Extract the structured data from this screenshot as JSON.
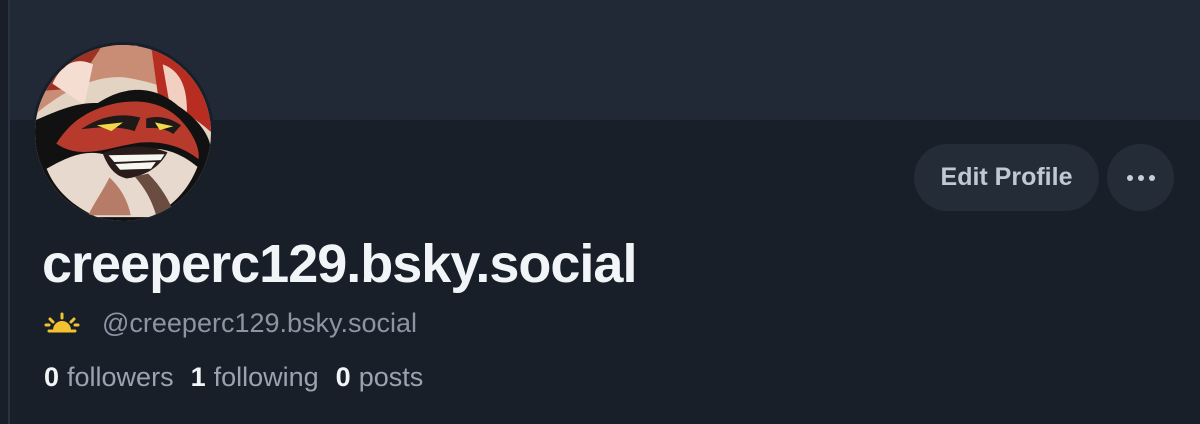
{
  "profile": {
    "display_name": "creeperc129.bsky.social",
    "handle": "@creeperc129.bsky.social",
    "status_icon": "sun-rising-icon",
    "avatar_icon": "red-fox-character-avatar"
  },
  "actions": {
    "edit_label": "Edit Profile",
    "more_icon": "more-dots-icon"
  },
  "stats": {
    "followers_count": "0",
    "followers_label": "followers",
    "following_count": "1",
    "following_label": "following",
    "posts_count": "0",
    "posts_label": "posts"
  },
  "colors": {
    "background": "#181f29",
    "banner": "#222936",
    "button": "#242c38",
    "text_primary": "#f2f5f8",
    "text_secondary": "#8b95a3",
    "sun": "#f2c230"
  }
}
